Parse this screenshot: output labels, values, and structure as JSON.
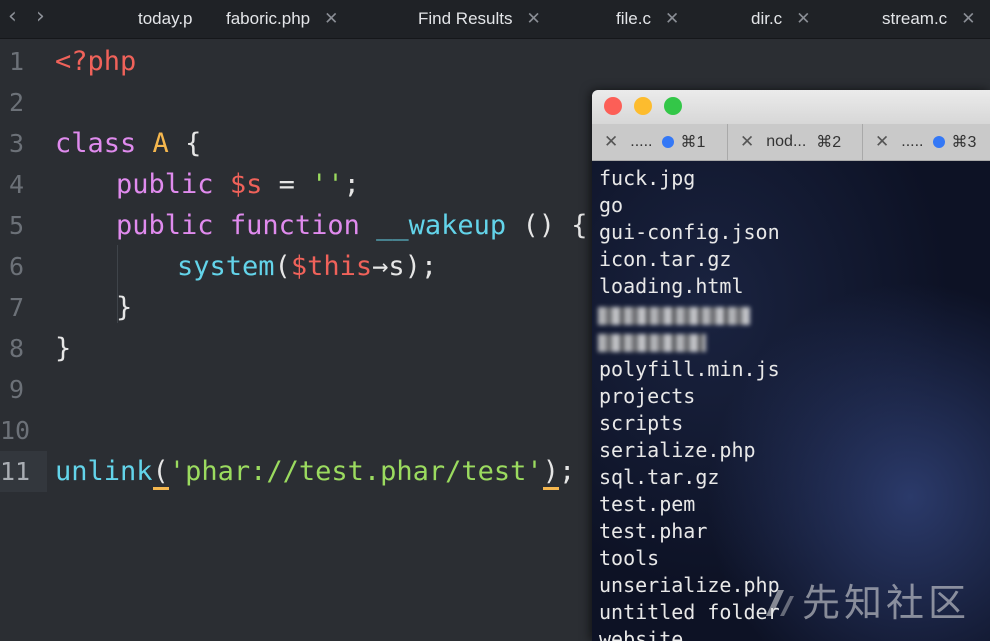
{
  "tabbar": {
    "back_arrow": "‹",
    "forward_arrow": "›",
    "tabs": [
      {
        "label": "today.p",
        "close": ""
      },
      {
        "label": "faboric.php",
        "close": "✕"
      },
      {
        "label": "Find Results",
        "close": "✕"
      },
      {
        "label": "file.c",
        "close": "✕"
      },
      {
        "label": "dir.c",
        "close": "✕"
      },
      {
        "label": "stream.c",
        "close": "✕"
      }
    ]
  },
  "editor": {
    "line_numbers": [
      "1",
      "2",
      "3",
      "4",
      "5",
      "6",
      "7",
      "8",
      "9",
      "10",
      "11"
    ],
    "active_line": "11",
    "code": {
      "l1_tag": "<?php",
      "l3_kw": "class",
      "l3_cls": "A",
      "l3_brace": "{",
      "l4_kw": "public",
      "l4_var": "$s",
      "l4_eq": "=",
      "l4_str": "''",
      "l4_semi": ";",
      "l5_kw1": "public",
      "l5_kw2": "function",
      "l5_fn": "__wakeup",
      "l5_rest": "() {",
      "l6_fn": "system",
      "l6_p1": "(",
      "l6_var": "$this",
      "l6_arrow": "→s",
      "l6_p2": ");",
      "l7_brace": "}",
      "l8_brace": "}",
      "l11_fn": "unlink",
      "l11_p1": "(",
      "l11_str": "'phar://test.phar/test'",
      "l11_p2": ")",
      "l11_semi": ";"
    }
  },
  "terminal": {
    "window_colors": {
      "close": "#fc5f57",
      "minimize": "#fdbc2e",
      "zoom": "#33c748"
    },
    "tabs": [
      {
        "title": ".....",
        "shortcut": "⌘1"
      },
      {
        "title": "nod...",
        "shortcut": "⌘2"
      },
      {
        "title": ".....",
        "shortcut": "⌘3"
      }
    ],
    "files": [
      "fuck.jpg",
      "go",
      "gui-config.json",
      "icon.tar.gz",
      "loading.html",
      "",
      "",
      "polyfill.min.js",
      "projects",
      "scripts",
      "serialize.php",
      "sql.tar.gz",
      "test.pem",
      "test.phar",
      "tools",
      "unserialize.php",
      "untitled folder",
      "website"
    ]
  },
  "watermark": "先知社区"
}
